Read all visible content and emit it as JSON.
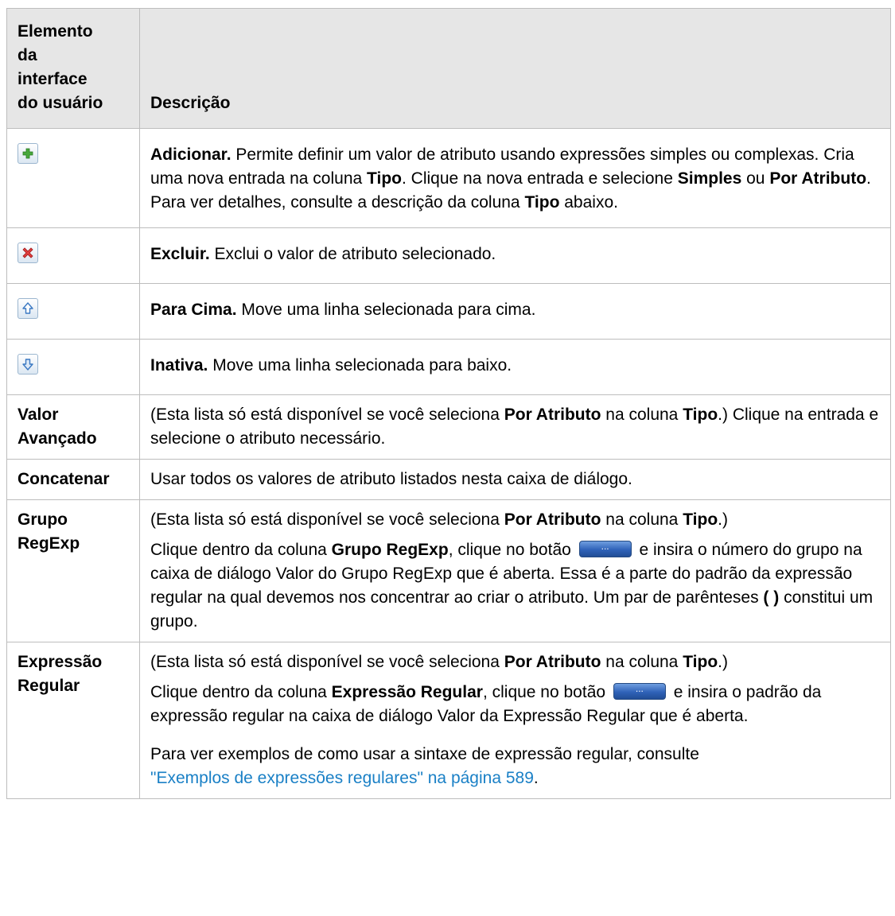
{
  "table": {
    "header": {
      "col1": [
        "Elemento",
        "da",
        "interface",
        "do usuário"
      ],
      "col2": "Descrição"
    },
    "rows": [
      {
        "icon": "add-icon",
        "title": "Adicionar.",
        "t1": " Permite definir um valor de atributo usando expressões simples ou complexas. Cria uma nova entrada na coluna ",
        "b1": "Tipo",
        "t2": ". Clique na nova entrada e selecione ",
        "b2": "Simples",
        "t3": " ou ",
        "b3": "Por Atributo",
        "t4": ". Para ver detalhes, consulte a descrição da coluna ",
        "b4": "Tipo",
        "t5": " abaixo."
      },
      {
        "icon": "delete-icon",
        "title": "Excluir.",
        "text": " Exclui o valor de atributo selecionado."
      },
      {
        "icon": "move-up-icon",
        "title": "Para Cima.",
        "text": " Move uma linha selecionada para cima."
      },
      {
        "icon": "move-down-icon",
        "title": "Inativa.",
        "text": " Move uma linha selecionada para baixo."
      },
      {
        "name": [
          "Valor",
          "Avançado"
        ],
        "t1": "(Esta lista só está disponível se você seleciona ",
        "b1": "Por Atributo",
        "t2": " na coluna ",
        "b2": "Tipo",
        "t3": ".) Clique na entrada e selecione o atributo necessário."
      },
      {
        "name": "Concatenar",
        "text": "Usar todos os valores de atributo listados nesta caixa de diálogo."
      },
      {
        "name": [
          "Grupo",
          "RegExp"
        ],
        "p1": {
          "t1": "(Esta lista só está disponível se você seleciona ",
          "b1": "Por Atributo",
          "t2": " na coluna ",
          "b2": "Tipo",
          "t3": ".)"
        },
        "p2": {
          "t1": "Clique dentro da coluna ",
          "b1": "Grupo RegExp",
          "t2": ", clique no botão ",
          "button": "...",
          "t3": " e insira o número do grupo na caixa de diálogo Valor do Grupo RegExp que é aberta. Essa é a parte do padrão da expressão regular na qual devemos nos concentrar ao criar o atributo. Um par de parênteses ",
          "b2": "( )",
          "t4": " constitui um grupo."
        }
      },
      {
        "name": [
          "Expressão",
          "Regular"
        ],
        "p1": {
          "t1": "(Esta lista só está disponível se você seleciona ",
          "b1": "Por Atributo",
          "t2": " na coluna ",
          "b2": "Tipo",
          "t3": ".)"
        },
        "p2": {
          "t1": "Clique dentro da coluna ",
          "b1": "Expressão Regular",
          "t2": ", clique no botão ",
          "button": "...",
          "t3": " e insira o padrão da expressão regular na caixa de diálogo Valor da Expressão Regular que é aberta."
        },
        "p3": {
          "t1": "Para ver exemplos de como usar a sintaxe de expressão regular, consulte ",
          "link": "\"Exemplos de expressões regulares\" na página 589",
          "t2": "."
        }
      }
    ]
  },
  "colors": {
    "link": "#1a80c6",
    "header_bg": "#e6e6e6",
    "border": "#bdbdbd"
  }
}
